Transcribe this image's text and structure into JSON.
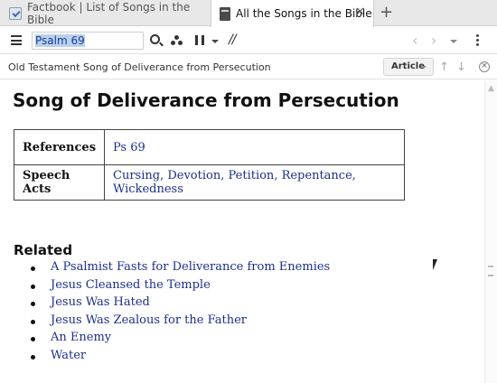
{
  "tabs": [
    {
      "label": "Factbook | List of Songs in the Bible",
      "icon": "factbook-icon",
      "active": false
    },
    {
      "label": "All the Songs in the Bible",
      "icon": "book-icon",
      "active": true,
      "close": "✕"
    }
  ],
  "tab_add": "+",
  "toolbar": {
    "reference_value": "Psalm 69",
    "link_glyph": "//",
    "back_glyph": "‹",
    "forward_glyph": "›"
  },
  "breadcrumb": {
    "items": [
      "Old Testament",
      "Song of Deliverance from Persecution"
    ],
    "separator": "›",
    "article_button": "Article",
    "up_glyph": "↑",
    "down_glyph": "↓",
    "clear_glyph": "×"
  },
  "article": {
    "title": "Song of Deliverance from Persecution",
    "table": {
      "references_label": "References",
      "references_value": "Ps 69",
      "speech_acts_label": "Speech Acts",
      "speech_acts": [
        "Cursing",
        "Devotion",
        "Petition",
        "Repentance",
        "Wickedness"
      ],
      "speech_acts_separator": ", "
    },
    "related_heading": "Related",
    "related": [
      "A Psalmist Fasts for Deliverance from Enemies",
      "Jesus Cleansed the Temple",
      "Jesus Was Hated",
      "Jesus Was Zealous for the Father",
      "An Enemy",
      "Water"
    ]
  },
  "colors": {
    "link": "#1c2f8a",
    "selection": "#b9d1ee"
  }
}
